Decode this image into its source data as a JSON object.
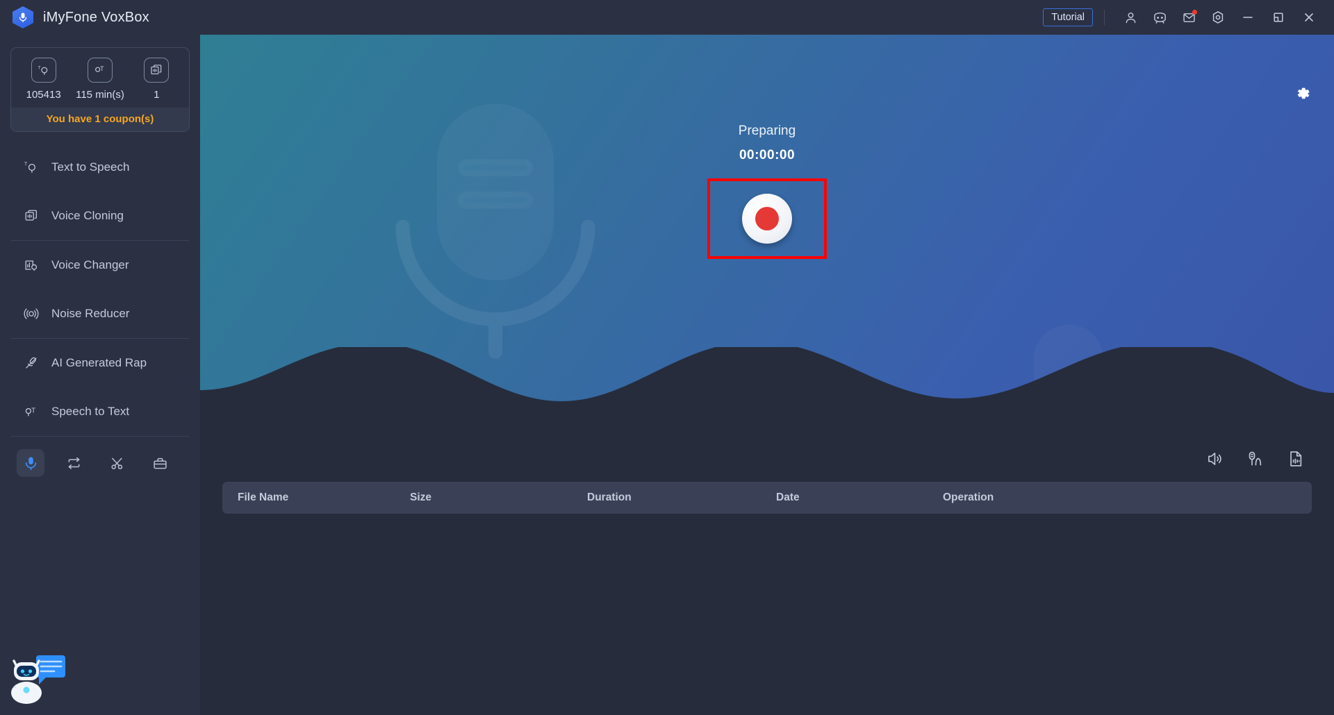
{
  "window": {
    "app_title": "iMyFone VoxBox",
    "logo_icon": "microphone-hexagon-logo",
    "tutorial_label": "Tutorial",
    "icons": {
      "account": "user-icon",
      "community": "discord-icon",
      "mail": "mail-icon",
      "settings": "settings-hexagon-icon",
      "minimize": "minimize-icon",
      "restore": "restore-icon",
      "close": "close-icon"
    }
  },
  "sidebar": {
    "credits": {
      "items": [
        {
          "icon": "text-to-speech-icon",
          "value": "105413"
        },
        {
          "icon": "speech-to-text-icon",
          "value": "115 min(s)"
        },
        {
          "icon": "voice-cloning-icon",
          "value": "1"
        }
      ],
      "coupon_text": "You have 1 coupon(s)"
    },
    "nav_items": [
      {
        "icon": "text-to-speech-icon",
        "label": "Text to Speech"
      },
      {
        "icon": "voice-cloning-icon",
        "label": "Voice Cloning"
      },
      {
        "icon": "voice-changer-icon",
        "label": "Voice Changer"
      },
      {
        "icon": "noise-reducer-icon",
        "label": "Noise Reducer"
      },
      {
        "icon": "ai-generated-rap-icon",
        "label": "AI Generated Rap"
      },
      {
        "icon": "speech-to-text-icon",
        "label": "Speech to Text"
      }
    ],
    "tools": [
      {
        "icon": "recorder-icon",
        "active": true
      },
      {
        "icon": "converter-icon",
        "active": false
      },
      {
        "icon": "cutter-icon",
        "active": false
      },
      {
        "icon": "toolbox-icon",
        "active": false
      }
    ],
    "mascot_icon": "chatbot-assistant-icon"
  },
  "hero": {
    "settings_icon": "gear-icon",
    "watermark_icon": "microphone-watermark",
    "status_text": "Preparing",
    "timer": "00:00:00",
    "record_button_icon": "record-button",
    "highlight_color": "#ff0000"
  },
  "file_list": {
    "tools": [
      {
        "icon": "speaker-icon"
      },
      {
        "icon": "microphone-wave-icon"
      },
      {
        "icon": "audio-file-icon"
      }
    ],
    "columns": [
      "File Name",
      "Size",
      "Duration",
      "Date",
      "Operation"
    ],
    "rows": []
  },
  "colors": {
    "accent": "#3a6fd8",
    "coupon": "#f5a623",
    "record": "#e53935",
    "sidebar_bg": "#2b3143",
    "content_bg": "#262c3c"
  }
}
